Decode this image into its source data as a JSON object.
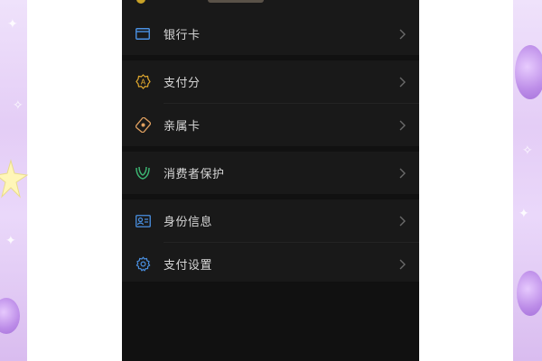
{
  "background": {
    "left_color": "#e4cdf6",
    "right_color": "#d9bcef",
    "screen_color": "#111111",
    "row_color": "#191919"
  },
  "groups": [
    {
      "items": [
        {
          "label": "银行卡",
          "icon": "bank-card-icon",
          "icon_color": "#4a90e2"
        }
      ]
    },
    {
      "items": [
        {
          "label": "支付分",
          "icon": "pay-score-icon",
          "icon_color": "#e0a82e"
        },
        {
          "label": "亲属卡",
          "icon": "family-card-icon",
          "icon_color": "#e0a060"
        }
      ]
    },
    {
      "items": [
        {
          "label": "消费者保护",
          "icon": "consumer-protection-icon",
          "icon_color": "#3cb371"
        }
      ]
    },
    {
      "items": [
        {
          "label": "身份信息",
          "icon": "id-info-icon",
          "icon_color": "#4a90e2"
        },
        {
          "label": "支付设置",
          "icon": "settings-gear-icon",
          "icon_color": "#4a90e2"
        }
      ]
    }
  ],
  "chevron_color": "#6a6a6a"
}
